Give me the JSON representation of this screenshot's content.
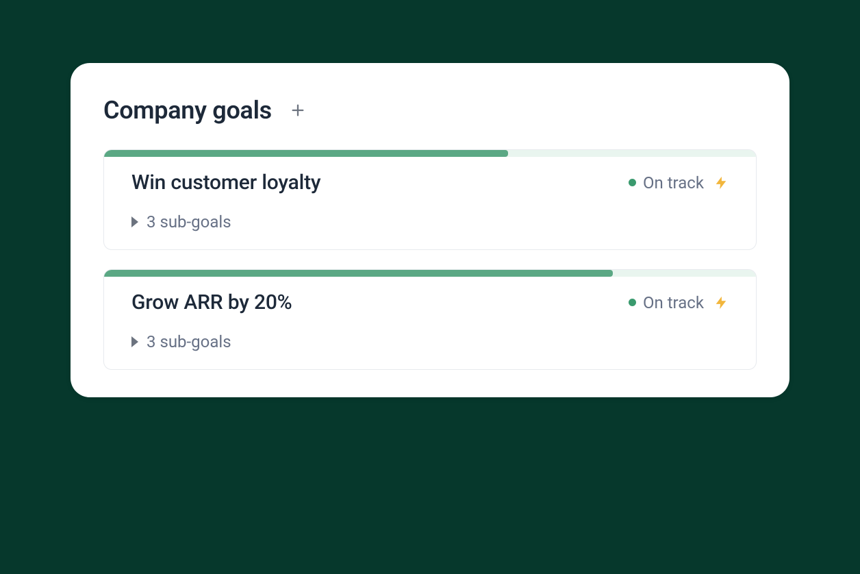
{
  "header": {
    "title": "Company goals"
  },
  "goals": [
    {
      "title": "Win customer loyalty",
      "status": "On track",
      "subgoals": "3 sub-goals",
      "progress_pct": 62
    },
    {
      "title": "Grow ARR by 20%",
      "status": "On track",
      "subgoals": "3 sub-goals",
      "progress_pct": 78
    }
  ]
}
